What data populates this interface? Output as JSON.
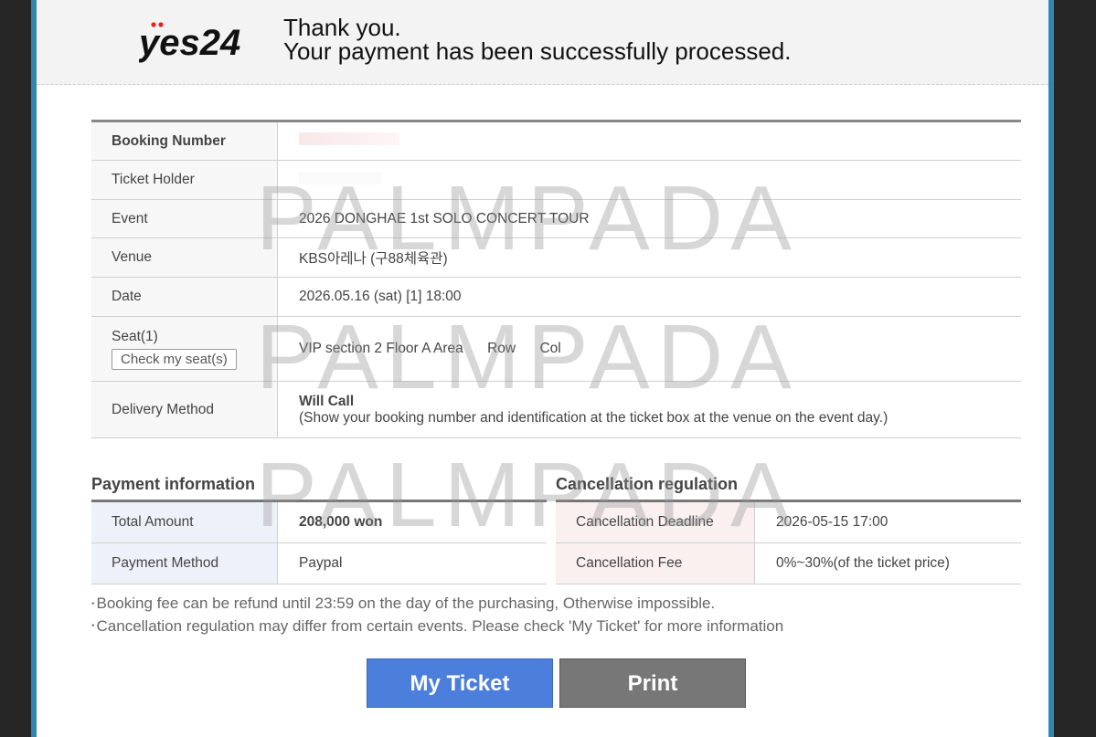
{
  "header": {
    "logo_text": "yes24",
    "thanks_line1": "Thank you.",
    "thanks_line2": "Your payment has been successfully processed."
  },
  "booking": {
    "rows": [
      {
        "label": "Booking Number",
        "value": ""
      },
      {
        "label": "Ticket Holder",
        "value": ""
      },
      {
        "label": "Event",
        "value": "2026 DONGHAE 1st SOLO CONCERT TOUR"
      },
      {
        "label": "Venue",
        "value": "KBS아레나 (구88체육관)"
      },
      {
        "label": "Date",
        "value": "2026.05.16 (sat) [1] 18:00"
      }
    ],
    "seat": {
      "label": "Seat(1)",
      "button_label": "Check my seat(s)",
      "section": "VIP section 2 Floor A Area",
      "row": "Row",
      "col": "Col"
    },
    "delivery": {
      "label": "Delivery Method",
      "method": "Will Call",
      "detail": "(Show your booking number and identification at the ticket box at the venue on the event day.)"
    }
  },
  "payment": {
    "title": "Payment information",
    "total_label": "Total Amount",
    "total_value": "208,000 won",
    "method_label": "Payment Method",
    "method_value": "Paypal"
  },
  "cancellation": {
    "title": "Cancellation regulation",
    "deadline_label": "Cancellation Deadline",
    "deadline_value": "2026-05-15 17:00",
    "fee_label": "Cancellation Fee",
    "fee_value": "0%~30%(of the ticket price)"
  },
  "notes": {
    "line1": "Booking fee can be refund until 23:59 on the day of the purchasing, Otherwise impossible.",
    "line2": "Cancellation regulation may differ from certain events. Please check 'My Ticket' for more information"
  },
  "buttons": {
    "my_ticket": "My Ticket",
    "print": "Print"
  },
  "watermark": "PALMPADA",
  "colors": {
    "accent_blue": "#4b7fdb",
    "frame_blue": "#2f86b3",
    "deadline_red": "#c8383a",
    "print_gray": "#777777",
    "logo_red": "#e0232a"
  }
}
